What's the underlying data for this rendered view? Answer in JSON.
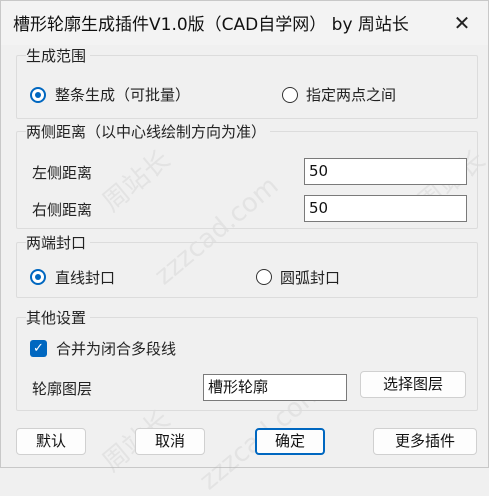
{
  "window": {
    "title": "槽形轮廓生成插件V1.0版（CAD自学网） by 周站长",
    "close_glyph": "✕"
  },
  "generate_range": {
    "title": "生成范围",
    "option_all": "整条生成（可批量）",
    "option_two_points": "指定两点之间",
    "selected": "option_all"
  },
  "distance": {
    "title": "两侧距离（以中心线绘制方向为准）",
    "left_label": "左侧距离",
    "left_value": "50",
    "right_label": "右侧距离",
    "right_value": "50"
  },
  "ends": {
    "title": "两端封口",
    "option_line": "直线封口",
    "option_arc": "圆弧封口",
    "selected": "option_line"
  },
  "other": {
    "title": "其他设置",
    "merge_label": "合并为闭合多段线",
    "merge_checked": true,
    "layer_label": "轮廓图层",
    "layer_value": "槽形轮廓",
    "select_layer_button": "选择图层"
  },
  "footer": {
    "default_button": "默认",
    "cancel_button": "取消",
    "ok_button": "确定",
    "more_button": "更多插件"
  },
  "watermark": {
    "text_cn": "周站长",
    "text_url": "zzzcad.com"
  },
  "colors": {
    "accent": "#0067c0",
    "background": "#f0f0f0"
  }
}
